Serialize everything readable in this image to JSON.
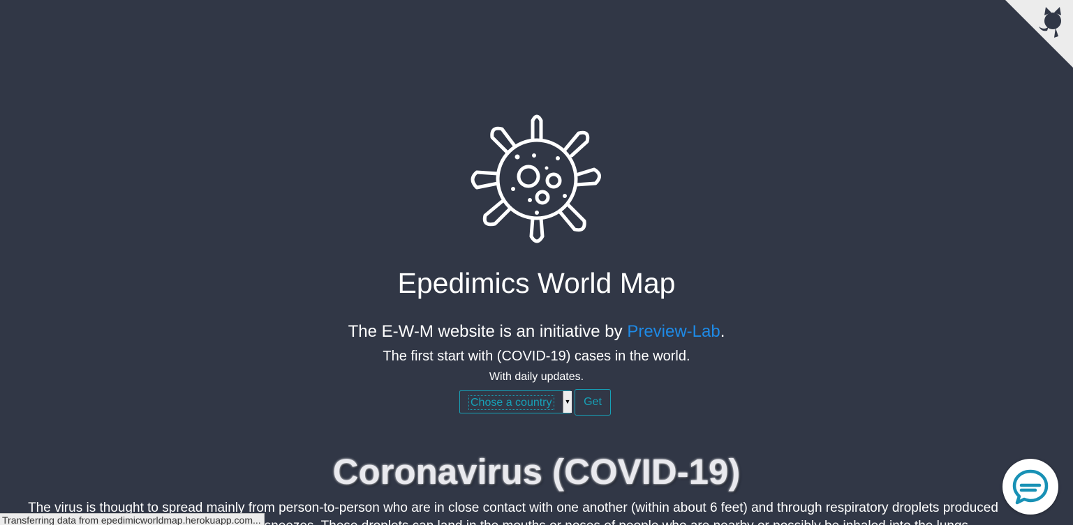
{
  "site": {
    "title": "Epedimics World Map",
    "intro_prefix": "The E-W-M website is an initiative by ",
    "intro_link": "Preview-Lab",
    "intro_suffix": ".",
    "first_line": "The first start with (COVID-19) cases in the world.",
    "daily_line": "With daily updates."
  },
  "country_form": {
    "selected": "Chose a country",
    "get_label": "Get"
  },
  "covid": {
    "heading": "Coronavirus (COVID-19)",
    "text": "The virus is thought to spread mainly from person-to-person who are in close contact with one another (within about 6 feet) and through respiratory droplets produced when an infected person coughs or sneezes. These droplets can land in the mouths or noses of people who are nearby or possibly be inhaled into the lungs."
  },
  "status_bar": {
    "text": "Transferring data from epedimicworldmap.herokuapp.com..."
  },
  "icons": {
    "corner": "github-corner-icon",
    "hero": "virus-icon",
    "chat": "chat-bubble-icon"
  },
  "colors": {
    "background": "#313746",
    "link": "#1e8ae6",
    "accent": "#17a2b8"
  }
}
